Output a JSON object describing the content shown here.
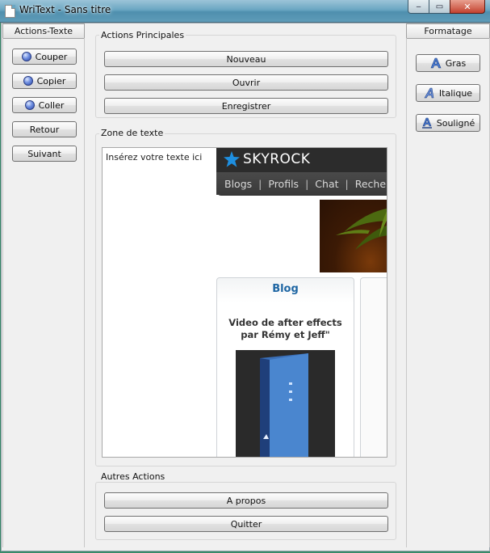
{
  "window": {
    "title": "WriText - Sans titre",
    "controls": {
      "minimize": "‒",
      "maximize": "▭",
      "close": "✕"
    }
  },
  "left_panel": {
    "tab_label": "Actions-Texte",
    "buttons": [
      {
        "label": "Couper",
        "icon": "orb-icon"
      },
      {
        "label": "Copier",
        "icon": "orb-icon"
      },
      {
        "label": "Coller",
        "icon": "orb-icon"
      },
      {
        "label": "Retour",
        "icon": ""
      },
      {
        "label": "Suivant",
        "icon": ""
      }
    ]
  },
  "right_panel": {
    "tab_label": "Formatage",
    "buttons": [
      {
        "label": "Gras",
        "icon": "bold-a-icon"
      },
      {
        "label": "Italique",
        "icon": "italic-a-icon"
      },
      {
        "label": "Souligné",
        "icon": "underline-a-icon"
      }
    ]
  },
  "main_actions": {
    "title": "Actions Principales",
    "buttons": [
      "Nouveau",
      "Ouvrir",
      "Enregistrer"
    ]
  },
  "text_zone": {
    "title": "Zone de texte",
    "content": "Insérez votre texte ici",
    "embedded_page": {
      "logo": "SKYROCK",
      "nav": [
        "Blogs",
        "Profils",
        "Chat",
        "Recherch"
      ],
      "card_title": "Blog",
      "card_subtitle": "Video de after effects par Rémy et Jeff\""
    }
  },
  "other_actions": {
    "title": "Autres Actions",
    "buttons": [
      "A propos",
      "Quitter"
    ]
  },
  "colors": {
    "accent_link": "#1e66a3",
    "titlebar": "#6aa6c2",
    "close_button": "#c4412e"
  }
}
